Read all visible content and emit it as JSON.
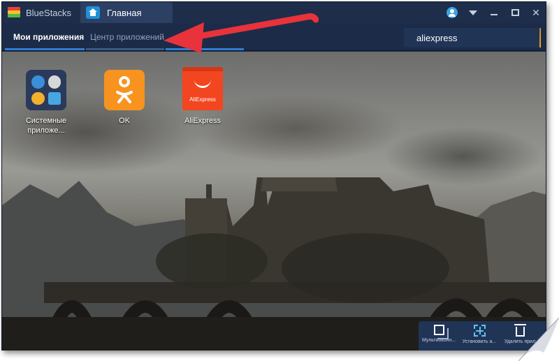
{
  "titlebar": {
    "app_name": "BlueStacks",
    "tab_label": "Главная"
  },
  "nav": {
    "tabs": [
      {
        "label": "Мои приложения",
        "active": true
      },
      {
        "label": "Центр приложений",
        "active": false
      }
    ]
  },
  "search": {
    "value": "aliexpress"
  },
  "apps": [
    {
      "label": "Системные приложе..."
    },
    {
      "label": "OK"
    },
    {
      "label": "AliExpress",
      "icon_text": "AliExpress"
    }
  ],
  "toolbar": {
    "items": [
      {
        "label": "Мультиоконн...",
        "icon": "multi-window-icon"
      },
      {
        "label": "Установить а...",
        "icon": "install-apk-icon"
      },
      {
        "label": "Удалить прил",
        "icon": "trash-icon"
      }
    ]
  },
  "colors": {
    "accent_blue": "#2f7fd6",
    "search_orange": "#f4a41b",
    "annotation_red": "#e8323c",
    "ok_orange": "#f7931e",
    "aliexpress_red": "#f1461f"
  }
}
